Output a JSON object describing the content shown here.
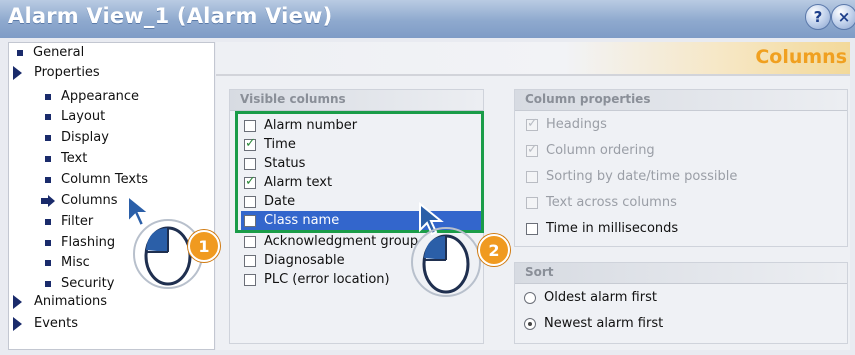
{
  "window": {
    "title": "Alarm View_1 (Alarm View)",
    "help_icon": "pin-help-icon",
    "close_icon": "close-icon"
  },
  "nav": {
    "items": [
      {
        "label": "General",
        "marker": "bullet"
      },
      {
        "label": "Properties",
        "marker": "triangle"
      },
      {
        "label": "Appearance",
        "marker": "bullet"
      },
      {
        "label": "Layout",
        "marker": "bullet"
      },
      {
        "label": "Display",
        "marker": "bullet"
      },
      {
        "label": "Text",
        "marker": "bullet"
      },
      {
        "label": "Column Texts",
        "marker": "bullet"
      },
      {
        "label": "Columns",
        "marker": "arrow",
        "selected": true
      },
      {
        "label": "Filter",
        "marker": "bullet"
      },
      {
        "label": "Flashing",
        "marker": "bullet"
      },
      {
        "label": "Misc",
        "marker": "bullet"
      },
      {
        "label": "Security",
        "marker": "bullet"
      },
      {
        "label": "Animations",
        "marker": "triangle"
      },
      {
        "label": "Events",
        "marker": "triangle"
      }
    ]
  },
  "header": {
    "title": "Columns"
  },
  "visible_columns": {
    "title": "Visible columns",
    "items": [
      {
        "label": "Alarm number",
        "checked": false
      },
      {
        "label": "Time",
        "checked": true
      },
      {
        "label": "Status",
        "checked": false
      },
      {
        "label": "Alarm text",
        "checked": true
      },
      {
        "label": "Date",
        "checked": false
      },
      {
        "label": "Class name",
        "checked": false,
        "highlighted": true
      },
      {
        "label": "Acknowledgment group",
        "checked": false
      },
      {
        "label": "Diagnosable",
        "checked": false
      },
      {
        "label": "PLC (error location)",
        "checked": false
      }
    ]
  },
  "column_properties": {
    "title": "Column properties",
    "items": [
      {
        "label": "Headings",
        "checked": true,
        "enabled": false
      },
      {
        "label": "Column ordering",
        "checked": true,
        "enabled": false
      },
      {
        "label": "Sorting by date/time possible",
        "checked": false,
        "enabled": false
      },
      {
        "label": "Text across columns",
        "checked": false,
        "enabled": false
      },
      {
        "label": "Time in milliseconds",
        "checked": false,
        "enabled": true
      }
    ]
  },
  "sort": {
    "title": "Sort",
    "options": [
      {
        "label": "Oldest alarm first",
        "selected": false
      },
      {
        "label": "Newest alarm first",
        "selected": true
      }
    ]
  },
  "callouts": [
    {
      "number": "1"
    },
    {
      "number": "2"
    }
  ],
  "colors": {
    "accent_header": "#f0a020",
    "highlight_box": "#1a9c48",
    "selection": "#3366cc",
    "badge": "#f09a20"
  }
}
